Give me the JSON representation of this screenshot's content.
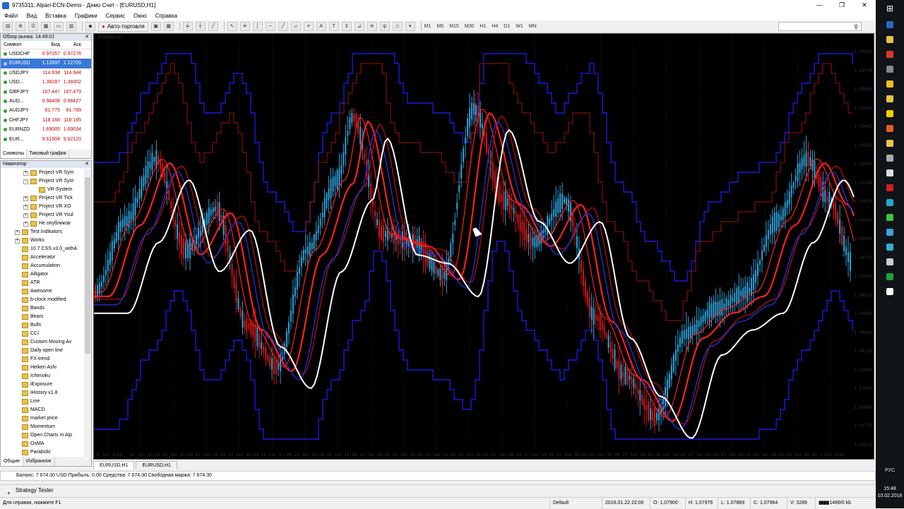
{
  "window": {
    "title": "9735311: Alpari-ECN-Demo - Демо Счет - [EURUSD,H1]",
    "minimize": "—",
    "maximize": "❐",
    "close": "✕"
  },
  "menu": [
    "Файл",
    "Вид",
    "Вставка",
    "Графики",
    "Сервис",
    "Окно",
    "Справка"
  ],
  "toolbar": {
    "autotrading_label": "Авто-торговля",
    "timeframes": [
      "M1",
      "M5",
      "M15",
      "M30",
      "H1",
      "H4",
      "D1",
      "W1",
      "MN"
    ]
  },
  "market_watch": {
    "title": "Обзор рынка: 14:49:01",
    "columns": [
      "Символ",
      "Бид",
      "Аск"
    ],
    "rows": [
      {
        "symbol": "USDCHF",
        "bid": "0.97267",
        "ask": "0.97276"
      },
      {
        "symbol": "EURUSD",
        "bid": "1.12697",
        "ask": "1.12705",
        "selected": true
      },
      {
        "symbol": "USDJPY",
        "bid": "114.934",
        "ask": "114.944"
      },
      {
        "symbol": "USD...",
        "bid": "1.38287",
        "ask": "1.38302"
      },
      {
        "symbol": "GBPJPY",
        "bid": "167.447",
        "ask": "167.479"
      },
      {
        "symbol": "AUD...",
        "bid": "0.98408",
        "ask": "0.98427"
      },
      {
        "symbol": "AUDJPY",
        "bid": "81.775",
        "ask": "81.789"
      },
      {
        "symbol": "CHFJPY",
        "bid": "118.168",
        "ask": "118.185"
      },
      {
        "symbol": "EURNZD",
        "bid": "1.69005",
        "ask": "1.69034"
      },
      {
        "symbol": "EUR...",
        "bid": "9.61904",
        "ask": "9.62120"
      }
    ],
    "tabs": [
      "Символы",
      "Тиковый график"
    ]
  },
  "navigator": {
    "title": "Навигатор",
    "items": [
      {
        "label": "Project VR Sym",
        "indent": 2,
        "exp": "+"
      },
      {
        "label": "Project VR Syst",
        "indent": 2,
        "exp": "−"
      },
      {
        "label": "VR-System",
        "indent": 3,
        "exp": ""
      },
      {
        "label": "Project VR Tick",
        "indent": 2,
        "exp": "+"
      },
      {
        "label": "Project VR XO",
        "indent": 2,
        "exp": "+"
      },
      {
        "label": "Project VR Youl",
        "indent": 2,
        "exp": "+"
      },
      {
        "label": "Не опубликов",
        "indent": 2,
        "exp": "+"
      },
      {
        "label": "Test Indikators",
        "indent": 1,
        "exp": "+"
      },
      {
        "label": "Works",
        "indent": 1,
        "exp": "+"
      },
      {
        "label": "10.7 CSS.v3.0_withA",
        "indent": 1,
        "exp": ""
      },
      {
        "label": "Accelerator",
        "indent": 1,
        "exp": ""
      },
      {
        "label": "Accumulation",
        "indent": 1,
        "exp": ""
      },
      {
        "label": "Alligator",
        "indent": 1,
        "exp": ""
      },
      {
        "label": "ATR",
        "indent": 1,
        "exp": ""
      },
      {
        "label": "Awesome",
        "indent": 1,
        "exp": ""
      },
      {
        "label": "b-clock modified",
        "indent": 1,
        "exp": ""
      },
      {
        "label": "Bands",
        "indent": 1,
        "exp": ""
      },
      {
        "label": "Bears",
        "indent": 1,
        "exp": ""
      },
      {
        "label": "Bulls",
        "indent": 1,
        "exp": ""
      },
      {
        "label": "CCI",
        "indent": 1,
        "exp": ""
      },
      {
        "label": "Custom Moving Av",
        "indent": 1,
        "exp": ""
      },
      {
        "label": "Daily open line",
        "indent": 1,
        "exp": ""
      },
      {
        "label": "FX-trend",
        "indent": 1,
        "exp": ""
      },
      {
        "label": "Heiken Ashi",
        "indent": 1,
        "exp": ""
      },
      {
        "label": "Ichimoku",
        "indent": 1,
        "exp": ""
      },
      {
        "label": "iExposure",
        "indent": 1,
        "exp": ""
      },
      {
        "label": "iHistory v1.8",
        "indent": 1,
        "exp": ""
      },
      {
        "label": "Line",
        "indent": 1,
        "exp": ""
      },
      {
        "label": "MACD",
        "indent": 1,
        "exp": ""
      },
      {
        "label": "market price",
        "indent": 1,
        "exp": ""
      },
      {
        "label": "Momentum",
        "indent": 1,
        "exp": ""
      },
      {
        "label": "Open Charts In Alp",
        "indent": 1,
        "exp": ""
      },
      {
        "label": "OsMA",
        "indent": 1,
        "exp": ""
      },
      {
        "label": "Parabolic",
        "indent": 1,
        "exp": ""
      }
    ],
    "tabs": [
      "Общие",
      "Избранное"
    ]
  },
  "chart": {
    "caption": "EURUSD,H1",
    "price_labels": [
      "1.09885",
      "1.09770",
      "1.09665",
      "1.09560",
      "1.09455",
      "1.09350",
      "1.09245",
      "1.09140",
      "1.09035",
      "1.08930",
      "1.08825",
      "1.08720",
      "1.08615",
      "1.08510",
      "1.08405",
      "1.08300",
      "1.08195",
      "1.08090",
      "1.07985",
      "1.07880",
      "1.07775",
      "1.07670"
    ],
    "time_labels": [
      "8 Jan 2016",
      "11 Jan 15:00",
      "12 Jan 07:00",
      "12 Jan 23:00",
      "13 Jan 15:00",
      "14 Jan 07:00",
      "14 Jan 23:00",
      "15 Jan 15:00",
      "18 Jan 08:00",
      "19 Jan 00:00",
      "19 Jan 16:00",
      "20 Jan 08:00",
      "21 Jan 00:00",
      "21 Jan 16:00",
      "22 Jan 08:00",
      "25 Jan 00:00",
      "25 Jan 16:00",
      "26 Jan 08:00",
      "27 Jan 00:00",
      "27 Jan 16:00",
      "28 Jan 08:00",
      "29 Jan 00:00",
      "1 Feb 2016"
    ]
  },
  "chart_tabs": [
    "EURUSD,H1",
    "EURUSD,H1"
  ],
  "balance_line": "Баланс: 7 674.30 USD  Прибыль: 0.00  Средства: 7 674.30  Свободная маржа: 7 674.30",
  "strategy_tester": "Strategy Tester",
  "status": {
    "help": "Для справки, нажмите F1",
    "profile": "Default",
    "datetime": "2016.01.22 22:00",
    "open": "O: 1.07900",
    "high": "H: 1.07976",
    "low": "L: 1.07889",
    "close": "C: 1.07964",
    "volume": "V: 3289",
    "traffic": "1489/0 kb"
  },
  "taskbar": {
    "lang": "РУС",
    "time": "15:48",
    "date": "10.02.2016",
    "icon_colors": [
      "#2a66c8",
      "#e8c34a",
      "#d93b2b",
      "#888888",
      "#f0c020",
      "#e8c34a",
      "#f5d000",
      "#e06020",
      "#e8c34a",
      "#aaaaaa",
      "#dddddd",
      "#cc2222",
      "#22aacc",
      "#40c040",
      "#40a0e0",
      "#30b0d0",
      "#cccccc",
      "#20a040",
      "#ffffff"
    ]
  },
  "colors": {
    "chart_bg": "#000000",
    "bull_candle": "#2fa0d8",
    "bear_candle": "#d01818",
    "ma_white": "#ffffff",
    "ma_red": "#ff2020",
    "ma_blue": "#2030d0",
    "channel_blue": "#1a1adc",
    "selected_row": "#3a78d8"
  }
}
